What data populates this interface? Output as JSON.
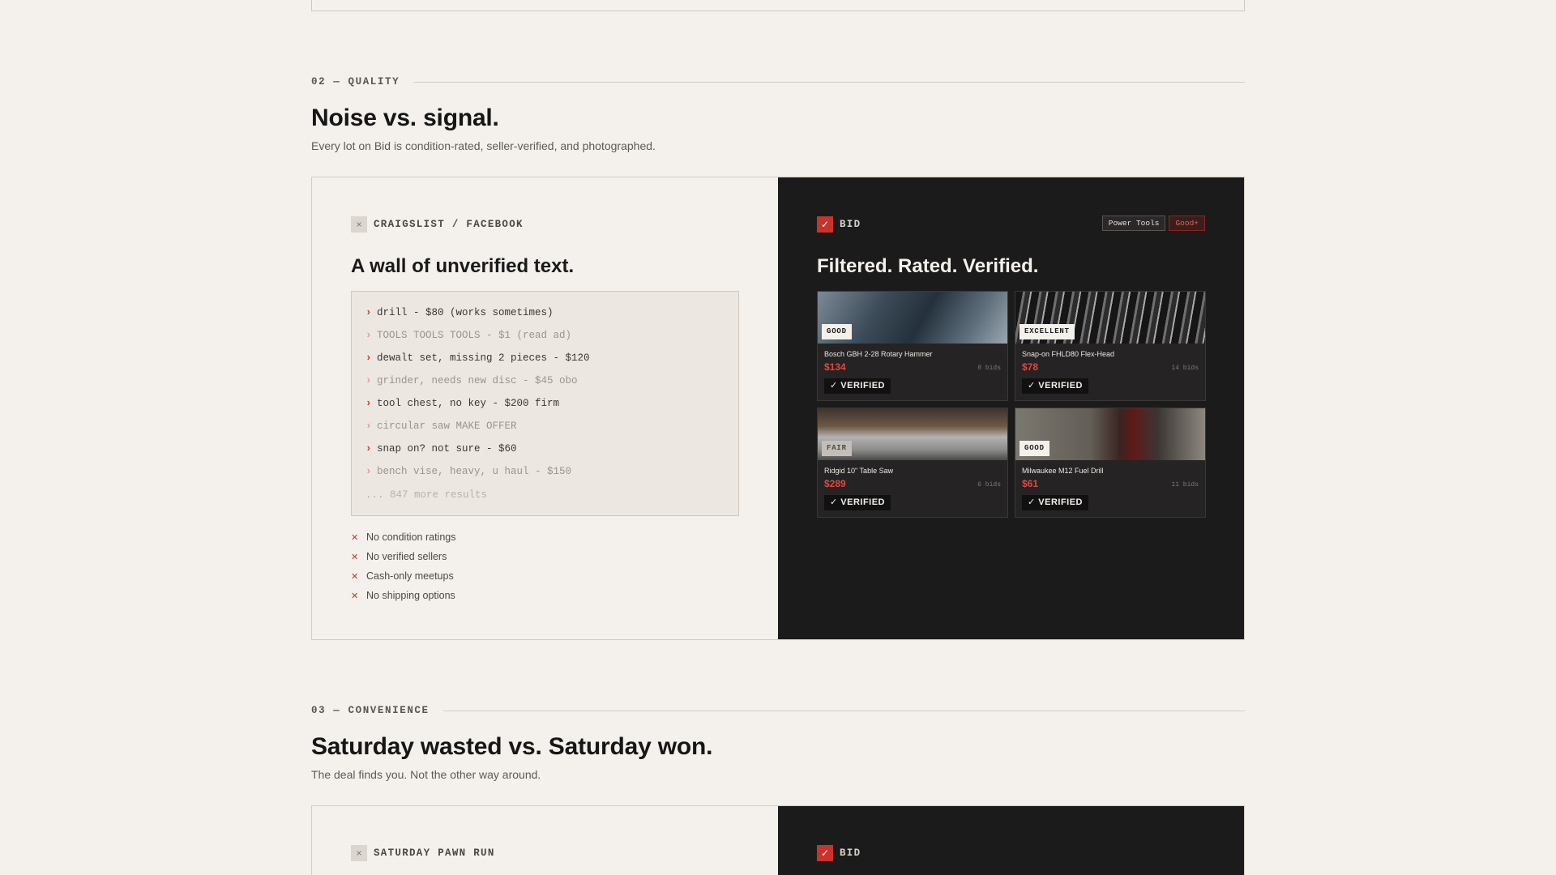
{
  "quality_section": {
    "eyebrow": "02 — QUALITY",
    "title": "Noise vs. signal.",
    "subtitle": "Every lot on Bid is condition-rated, seller-verified, and photographed."
  },
  "quality_left": {
    "icon": "x-icon",
    "icon_glyph": "×",
    "label": "CRAIGSLIST / FACEBOOK",
    "title": "A wall of unverified text.",
    "listings": [
      {
        "text": "drill - $80 (works sometimes)",
        "dim": false
      },
      {
        "text": "TOOLS TOOLS TOOLS - $1 (read ad)",
        "dim": true
      },
      {
        "text": "dewalt set, missing 2 pieces - $120",
        "dim": false
      },
      {
        "text": "grinder, needs new disc - $45 obo",
        "dim": true
      },
      {
        "text": "tool chest, no key - $200 firm",
        "dim": false
      },
      {
        "text": "circular saw MAKE OFFER",
        "dim": true
      },
      {
        "text": "snap on? not sure - $60",
        "dim": false
      },
      {
        "text": "bench vise, heavy, u haul - $150",
        "dim": true
      }
    ],
    "caret_glyph": "›",
    "more_results": "... 847 more results",
    "cons": [
      "No condition ratings",
      "No verified sellers",
      "Cash-only meetups",
      "No shipping options"
    ],
    "con_glyph": "✕"
  },
  "quality_right": {
    "icon": "check-icon",
    "icon_glyph": "✓",
    "label": "BID",
    "chips": [
      "Power Tools",
      "Good+"
    ],
    "title": "Filtered. Rated. Verified.",
    "verified_label": "✓ VERIFIED",
    "cards": [
      {
        "name": "Bosch GBH 2-28 Rotary Hammer",
        "price": "$134",
        "bids": "8 bids",
        "condition": "GOOD"
      },
      {
        "name": "Snap-on FHLD80 Flex-Head",
        "price": "$78",
        "bids": "14 bids",
        "condition": "EXCELLENT"
      },
      {
        "name": "Ridgid 10\" Table Saw",
        "price": "$289",
        "bids": "6 bids",
        "condition": "FAIR"
      },
      {
        "name": "Milwaukee M12 Fuel Drill",
        "price": "$61",
        "bids": "11 bids",
        "condition": "GOOD"
      }
    ]
  },
  "convenience_section": {
    "eyebrow": "03 — CONVENIENCE",
    "title": "Saturday wasted vs. Saturday won.",
    "subtitle": "The deal finds you. Not the other way around."
  },
  "convenience_left": {
    "icon": "x-icon",
    "icon_glyph": "×",
    "label": "SATURDAY PAWN RUN"
  },
  "convenience_right": {
    "icon": "check-icon",
    "icon_glyph": "✓",
    "label": "BID"
  },
  "colors": {
    "accent": "#c8332b",
    "background": "#f4f0eb",
    "dark_panel": "#1c1b1b"
  }
}
